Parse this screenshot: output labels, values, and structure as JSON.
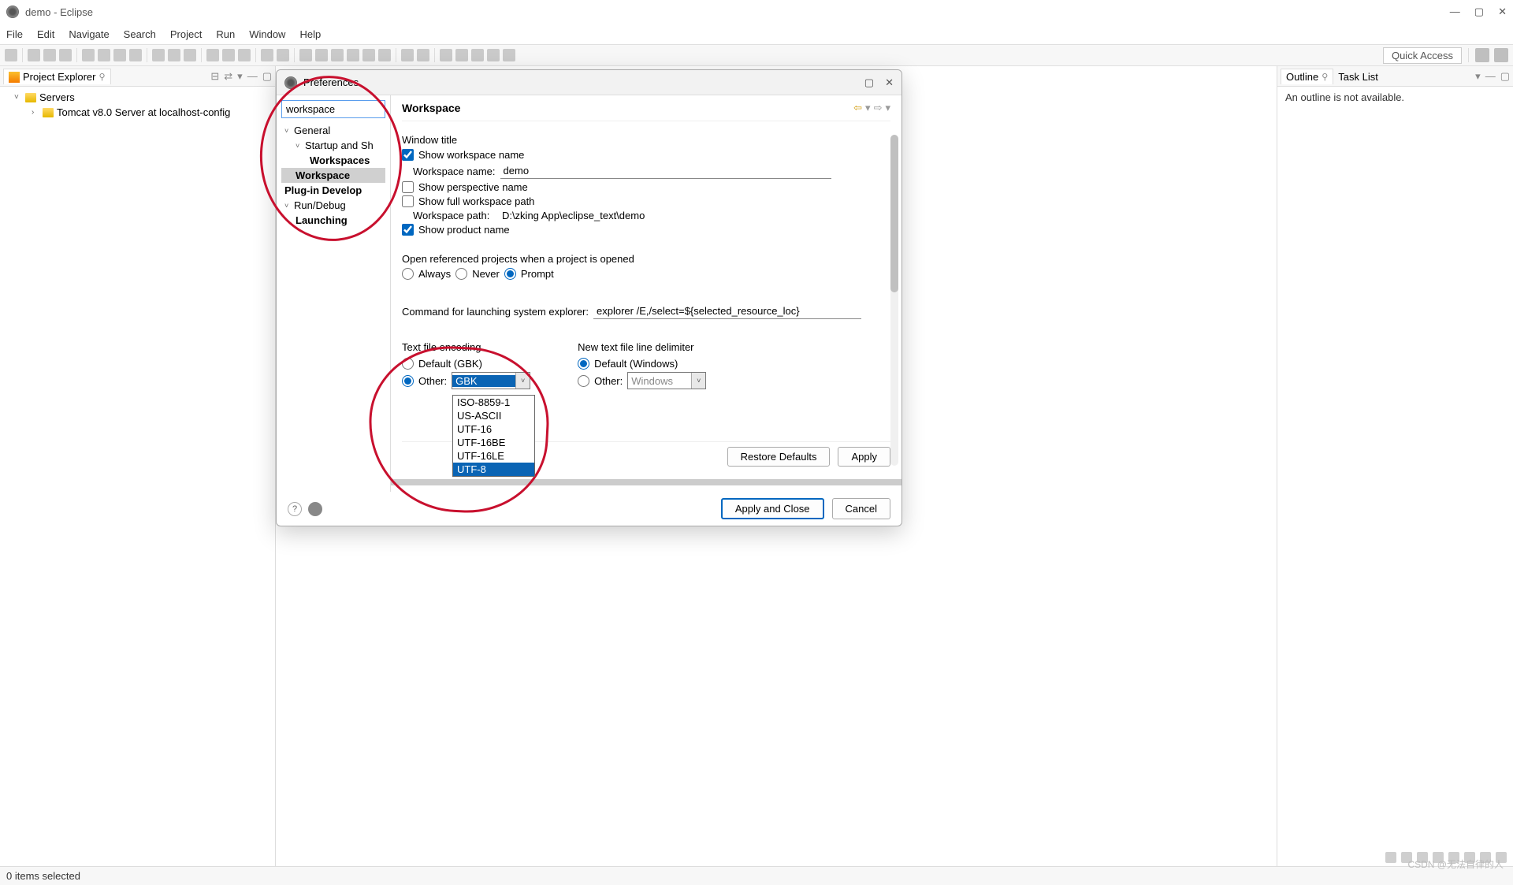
{
  "app": {
    "title": "demo - Eclipse"
  },
  "menubar": [
    "File",
    "Edit",
    "Navigate",
    "Search",
    "Project",
    "Run",
    "Window",
    "Help"
  ],
  "toolbar": {
    "quick_access": "Quick Access"
  },
  "projectExplorer": {
    "title": "Project Explorer",
    "items": [
      {
        "label": "Servers",
        "expanded": true
      },
      {
        "label": "Tomcat v8.0 Server at localhost-config"
      }
    ]
  },
  "outline": {
    "title": "Outline",
    "tasklist_title": "Task List",
    "message": "An outline is not available."
  },
  "statusbar": {
    "text": "0 items selected"
  },
  "dialog": {
    "title": "Preferences",
    "filter_value": "workspace",
    "tree": {
      "general": "General",
      "startup": "Startup and Sh",
      "workspaces": "Workspaces",
      "workspace": "Workspace",
      "plugindev": "Plug-in Develop",
      "rundebug": "Run/Debug",
      "launching": "Launching"
    },
    "page": {
      "heading": "Workspace",
      "window_title_label": "Window title",
      "show_ws_name_label": "Show workspace name",
      "ws_name_label": "Workspace name:",
      "ws_name_value": "demo",
      "show_perspective_label": "Show perspective name",
      "show_full_path_label": "Show full workspace path",
      "ws_path_label": "Workspace path:",
      "ws_path_value": "D:\\zking App\\eclipse_text\\demo",
      "show_product_label": "Show product name",
      "open_ref_label": "Open referenced projects when a project is opened",
      "radio_always": "Always",
      "radio_never": "Never",
      "radio_prompt": "Prompt",
      "cmd_label": "Command for launching system explorer:",
      "cmd_value": "explorer /E,/select=${selected_resource_loc}",
      "enc_label": "Text file encoding",
      "enc_default": "Default (GBK)",
      "enc_other": "Other:",
      "enc_selected": "GBK",
      "enc_options": [
        "ISO-8859-1",
        "US-ASCII",
        "UTF-16",
        "UTF-16BE",
        "UTF-16LE",
        "UTF-8"
      ],
      "delim_label": "New text file line delimiter",
      "delim_default": "Default (Windows)",
      "delim_other": "Other:",
      "delim_value": "Windows",
      "restore_btn": "Restore Defaults",
      "apply_btn": "Apply",
      "apply_close_btn": "Apply and Close",
      "cancel_btn": "Cancel"
    }
  },
  "watermark": "CSDN @无法自律的人"
}
